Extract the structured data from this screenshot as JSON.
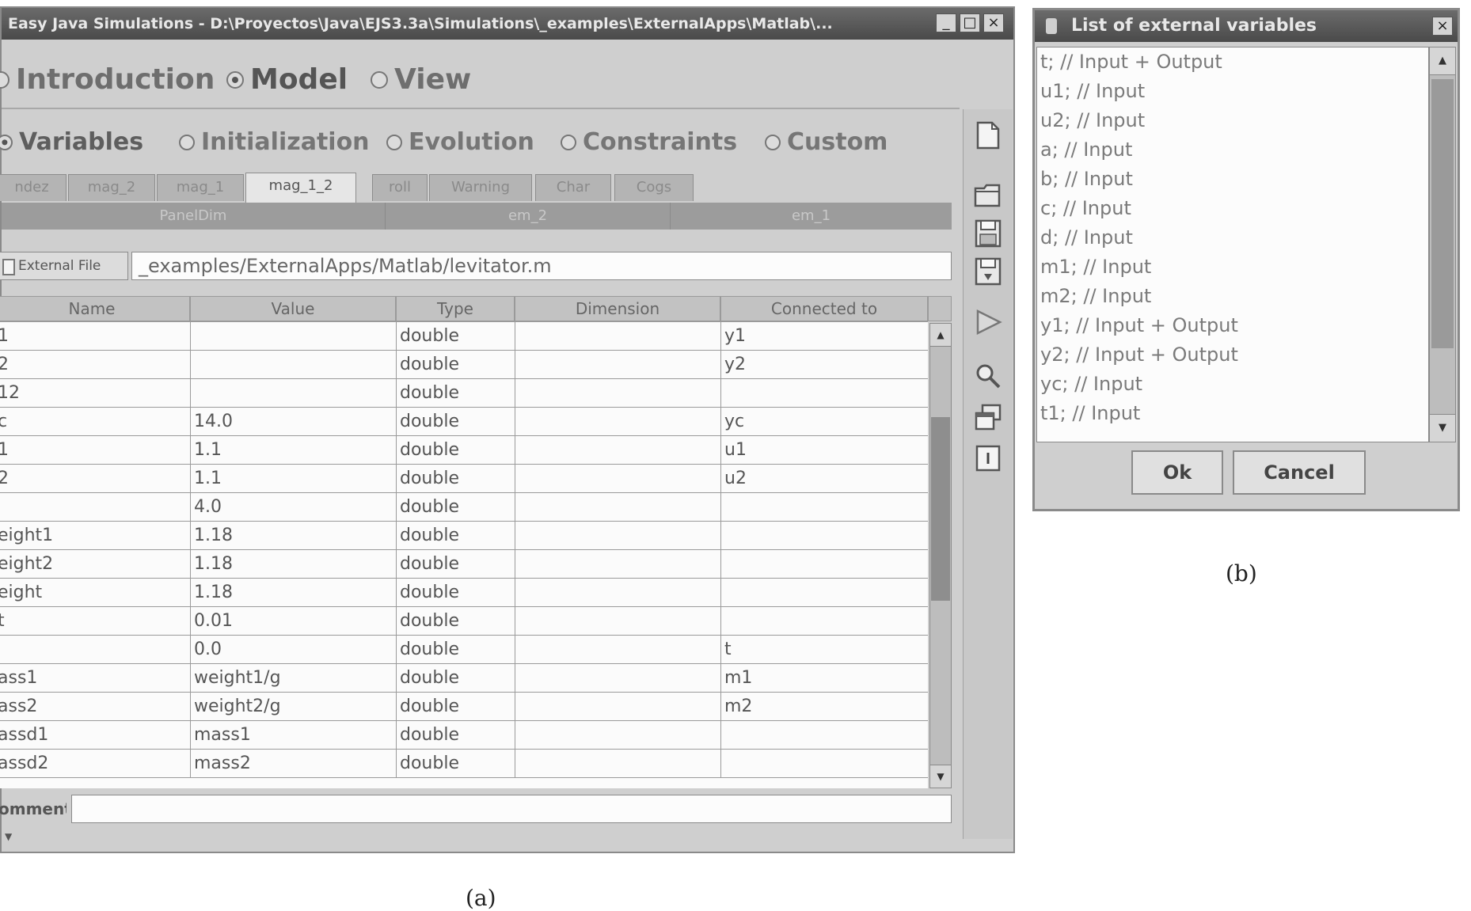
{
  "main_window": {
    "title": "Easy Java Simulations - D:\\Proyectos\\Java\\EJS3.3a\\Simulations\\_examples\\ExternalApps\\Matlab\\...",
    "main_tabs": [
      {
        "label": "Introduction",
        "selected": false
      },
      {
        "label": "Model",
        "selected": true
      },
      {
        "label": "View",
        "selected": false
      }
    ],
    "sub_tabs": [
      {
        "label": "Variables",
        "selected": true
      },
      {
        "label": "Initialization",
        "selected": false
      },
      {
        "label": "Evolution",
        "selected": false
      },
      {
        "label": "Constraints",
        "selected": false
      },
      {
        "label": "Custom",
        "selected": false
      }
    ],
    "var_pages": [
      {
        "label": "ndez",
        "active": false
      },
      {
        "label": "mag_2",
        "active": false
      },
      {
        "label": "mag_1",
        "active": false
      },
      {
        "label": "mag_1_2",
        "active": true
      },
      {
        "label": "roll",
        "active": false
      },
      {
        "label": "Warning",
        "active": false
      },
      {
        "label": "Char",
        "active": false
      },
      {
        "label": "Cogs",
        "active": false
      }
    ],
    "page_groups": [
      "PanelDim",
      "em_2",
      "em_1"
    ],
    "external_file": {
      "label": "External File",
      "value": "_examples/ExternalApps/Matlab/levitator.m"
    },
    "table": {
      "columns": [
        "Name",
        "Value",
        "Type",
        "Dimension",
        "Connected to"
      ],
      "rows": [
        [
          "1",
          "",
          "double",
          "",
          "y1"
        ],
        [
          "2",
          "",
          "double",
          "",
          "y2"
        ],
        [
          "12",
          "",
          "double",
          "",
          ""
        ],
        [
          "c",
          "14.0",
          "double",
          "",
          "yc"
        ],
        [
          "1",
          "1.1",
          "double",
          "",
          "u1"
        ],
        [
          "2",
          "1.1",
          "double",
          "",
          "u2"
        ],
        [
          "",
          "4.0",
          "double",
          "",
          ""
        ],
        [
          "eight1",
          "1.18",
          "double",
          "",
          ""
        ],
        [
          "eight2",
          "1.18",
          "double",
          "",
          ""
        ],
        [
          "eight",
          "1.18",
          "double",
          "",
          ""
        ],
        [
          "t",
          "0.01",
          "double",
          "",
          ""
        ],
        [
          "",
          "0.0",
          "double",
          "",
          "t"
        ],
        [
          "ass1",
          "weight1/g",
          "double",
          "",
          "m1"
        ],
        [
          "ass2",
          "weight2/g",
          "double",
          "",
          "m2"
        ],
        [
          "assd1",
          "mass1",
          "double",
          "",
          ""
        ],
        [
          "assd2",
          "mass2",
          "double",
          "",
          ""
        ]
      ]
    },
    "comment_label": "omment",
    "side_toolbar_icons": [
      "new-file-icon",
      "open-folder-icon",
      "save-icon",
      "save-as-icon",
      "run-icon",
      "search-icon",
      "windows-icon",
      "info-icon"
    ]
  },
  "dialog": {
    "title": "List of external variables",
    "items": [
      "t; // Input + Output",
      "u1; // Input",
      "u2; // Input",
      "a; // Input",
      "b; // Input",
      "c; // Input",
      "d; // Input",
      "m1; // Input",
      "m2; // Input",
      "y1; // Input + Output",
      "y2; // Input + Output",
      "yc; // Input",
      "t1; // Input"
    ],
    "ok_label": "Ok",
    "cancel_label": "Cancel"
  },
  "captions": {
    "a": "(a)",
    "b": "(b)"
  }
}
